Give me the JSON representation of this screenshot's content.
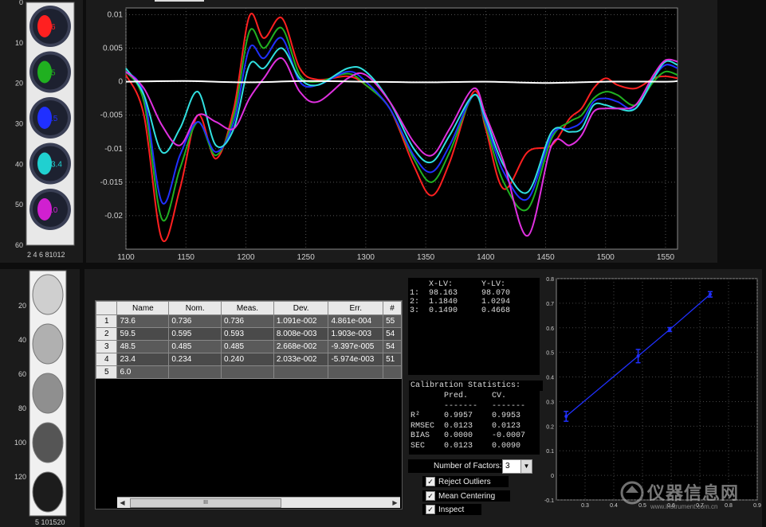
{
  "spots_panel": {
    "y_ticks": [
      "0",
      "10",
      "20",
      "30",
      "40",
      "50",
      "60"
    ],
    "x_ticks": "2 4 6 81012",
    "spot_labels": [
      "6",
      "5",
      ".5",
      "3.4",
      ".0"
    ],
    "spot_colors": [
      "#ff2020",
      "#20b020",
      "#2030ff",
      "#20d0d0",
      "#d020d0"
    ]
  },
  "spectra_chart": {
    "chart_data": {
      "type": "line",
      "xlim": [
        1100,
        1560
      ],
      "ylim": [
        -0.025,
        0.011
      ],
      "x_ticks": [
        "1100",
        "1150",
        "1200",
        "1250",
        "1300",
        "1350",
        "1400",
        "1450",
        "1500",
        "1550"
      ],
      "y_ticks": [
        "0.01",
        "0.005",
        "0",
        "-0.005",
        "-0.01",
        "-0.015",
        "-0.02"
      ],
      "grid": true,
      "series": [
        {
          "color": "#ff2020",
          "x": [
            1100,
            1115,
            1130,
            1145,
            1160,
            1175,
            1190,
            1203,
            1215,
            1230,
            1245,
            1260,
            1285,
            1300,
            1320,
            1340,
            1355,
            1370,
            1390,
            1400,
            1415,
            1435,
            1455,
            1470,
            1480,
            1490,
            1500,
            1510,
            1525,
            1540,
            1550,
            1560
          ],
          "y": [
            0.001,
            -0.005,
            -0.0235,
            -0.016,
            -0.005,
            -0.0115,
            -0.004,
            0.0098,
            0.0065,
            0.0095,
            0.002,
            0.0003,
            0.0008,
            -0.0005,
            -0.004,
            -0.0125,
            -0.017,
            -0.012,
            -0.0015,
            -0.007,
            -0.016,
            -0.0105,
            -0.0095,
            -0.0055,
            -0.004,
            -0.001,
            0.0005,
            -0.0005,
            -0.001,
            0.0005,
            0.0008,
            0.0005
          ]
        },
        {
          "color": "#20b020",
          "x": [
            1100,
            1115,
            1130,
            1145,
            1160,
            1175,
            1190,
            1203,
            1215,
            1230,
            1245,
            1260,
            1285,
            1300,
            1320,
            1340,
            1355,
            1370,
            1390,
            1400,
            1415,
            1435,
            1455,
            1470,
            1480,
            1490,
            1500,
            1510,
            1525,
            1540,
            1550,
            1560
          ],
          "y": [
            0.0015,
            -0.003,
            -0.0205,
            -0.013,
            -0.006,
            -0.011,
            -0.005,
            0.0075,
            0.005,
            0.008,
            0.001,
            0.0,
            0.0012,
            -0.0005,
            -0.004,
            -0.0115,
            -0.015,
            -0.0105,
            -0.002,
            -0.0065,
            -0.015,
            -0.019,
            -0.0085,
            -0.006,
            -0.005,
            -0.0025,
            -0.0015,
            -0.002,
            -0.0035,
            0.0,
            0.0015,
            0.001
          ]
        },
        {
          "color": "#2030ff",
          "x": [
            1100,
            1115,
            1130,
            1145,
            1160,
            1175,
            1190,
            1203,
            1215,
            1230,
            1245,
            1260,
            1285,
            1300,
            1320,
            1340,
            1355,
            1370,
            1390,
            1400,
            1415,
            1435,
            1455,
            1470,
            1480,
            1490,
            1500,
            1510,
            1525,
            1540,
            1550,
            1560
          ],
          "y": [
            0.0015,
            -0.002,
            -0.018,
            -0.011,
            -0.006,
            -0.0105,
            -0.006,
            0.005,
            0.0035,
            0.0065,
            0.0,
            -0.0005,
            0.0015,
            0.0,
            -0.004,
            -0.011,
            -0.0135,
            -0.0095,
            -0.002,
            -0.006,
            -0.0135,
            -0.0175,
            -0.008,
            -0.007,
            -0.006,
            -0.003,
            -0.0025,
            -0.003,
            -0.004,
            0.0005,
            0.0025,
            0.002
          ]
        },
        {
          "color": "#30e0e0",
          "x": [
            1100,
            1115,
            1130,
            1145,
            1160,
            1175,
            1190,
            1203,
            1215,
            1230,
            1245,
            1260,
            1285,
            1300,
            1320,
            1340,
            1355,
            1370,
            1390,
            1400,
            1415,
            1435,
            1455,
            1470,
            1480,
            1490,
            1500,
            1510,
            1525,
            1540,
            1550,
            1560
          ],
          "y": [
            0.002,
            -0.002,
            -0.0105,
            -0.007,
            -0.0015,
            -0.0095,
            -0.007,
            0.0025,
            0.002,
            0.005,
            0.0005,
            -0.0005,
            0.002,
            0.0015,
            -0.003,
            -0.01,
            -0.012,
            -0.008,
            -0.002,
            -0.0055,
            -0.0125,
            -0.0165,
            -0.0075,
            -0.0075,
            -0.007,
            -0.0035,
            -0.0035,
            -0.004,
            -0.004,
            0.0005,
            0.003,
            0.0025
          ]
        },
        {
          "color": "#e030e0",
          "x": [
            1100,
            1115,
            1130,
            1145,
            1160,
            1175,
            1190,
            1203,
            1215,
            1230,
            1245,
            1260,
            1285,
            1300,
            1320,
            1340,
            1355,
            1370,
            1390,
            1400,
            1415,
            1435,
            1455,
            1470,
            1480,
            1490,
            1500,
            1510,
            1525,
            1540,
            1550,
            1560
          ],
          "y": [
            0.0015,
            -0.001,
            -0.0065,
            -0.0095,
            -0.005,
            -0.006,
            -0.007,
            -0.0025,
            0.0005,
            0.0035,
            -0.0015,
            -0.003,
            0.0005,
            0.001,
            -0.003,
            -0.009,
            -0.011,
            -0.007,
            -0.001,
            -0.005,
            -0.012,
            -0.023,
            -0.0095,
            -0.0095,
            -0.008,
            -0.0045,
            -0.004,
            -0.004,
            -0.0035,
            0.001,
            0.0032,
            0.003
          ]
        },
        {
          "color": "#ffffff",
          "x": [
            1100,
            1150,
            1200,
            1250,
            1300,
            1350,
            1400,
            1450,
            1500,
            1550,
            1560
          ],
          "y": [
            0.0,
            0.0001,
            -0.0001,
            0.0001,
            0.0,
            -0.0001,
            0.0,
            -0.0002,
            0.0,
            0.0,
            0.0001
          ]
        }
      ]
    }
  },
  "images_panel": {
    "y_ticks": [
      "20",
      "40",
      "60",
      "80",
      "100",
      "120"
    ],
    "x_ticks": "5 101520",
    "spot_grays": [
      "#cfcfcf",
      "#b0b0b0",
      "#8f8f8f",
      "#555555",
      "#1c1c1c"
    ]
  },
  "table": {
    "columns": [
      "Name",
      "Nom.",
      "Meas.",
      "Dev.",
      "Err.",
      "#"
    ],
    "rows": [
      {
        "n": "1",
        "name": "73.6",
        "nom": "0.736",
        "meas": "0.736",
        "dev": "1.091e-002",
        "err": "4.861e-004",
        "h": "55"
      },
      {
        "n": "2",
        "name": "59.5",
        "nom": "0.595",
        "meas": "0.593",
        "dev": "8.008e-003",
        "err": "1.903e-003",
        "h": "54"
      },
      {
        "n": "3",
        "name": "48.5",
        "nom": "0.485",
        "meas": "0.485",
        "dev": "2.668e-002",
        "err": "-9.397e-005",
        "h": "54"
      },
      {
        "n": "4",
        "name": "23.4",
        "nom": "0.234",
        "meas": "0.240",
        "dev": "2.033e-002",
        "err": "-5.974e-003",
        "h": "51"
      },
      {
        "n": "5",
        "name": "6.0",
        "nom": "",
        "meas": "",
        "dev": "",
        "err": "",
        "h": ""
      }
    ],
    "scroll_grip": "III"
  },
  "lv_text": "    X-LV:      Y-LV:\n1:  98.163     98.070\n2:  1.1840     1.0294\n3:  0.1490     0.4668",
  "calib": {
    "title": "Calibration Statistics:",
    "body": "       Pred.     CV.\n       -------   -------\nR²     0.9957    0.9953\nRMSEC  0.0123    0.0123\nBIAS   0.0000    -0.0007\nSEC    0.0123    0.0090"
  },
  "controls": {
    "factors_label": "Number of Factors:",
    "factors_value": "3",
    "reject": "Reject Outliers",
    "mean_centering": "Mean Centering",
    "inspect": "Inspect",
    "check": "✓"
  },
  "calib_plot": {
    "chart_data": {
      "type": "scatter",
      "xlim": [
        0.2,
        0.9
      ],
      "ylim": [
        -0.1,
        0.8
      ],
      "x_ticks": [
        "0.3",
        "0.4",
        "0.5",
        "0.6",
        "0.7",
        "0.8",
        "0.9"
      ],
      "y_ticks": [
        "0.8",
        "0.7",
        "0.6",
        "0.5",
        "0.4",
        "0.3",
        "0.2",
        "0.1",
        "0",
        "-0.1"
      ],
      "line_color": "#2030ff",
      "x": [
        0.234,
        0.485,
        0.595,
        0.736
      ],
      "y": [
        0.24,
        0.485,
        0.593,
        0.736
      ],
      "err": [
        0.02,
        0.027,
        0.008,
        0.011
      ]
    }
  },
  "watermark": {
    "text": "仪器信息网",
    "url": "www.instrument.com.cn"
  }
}
